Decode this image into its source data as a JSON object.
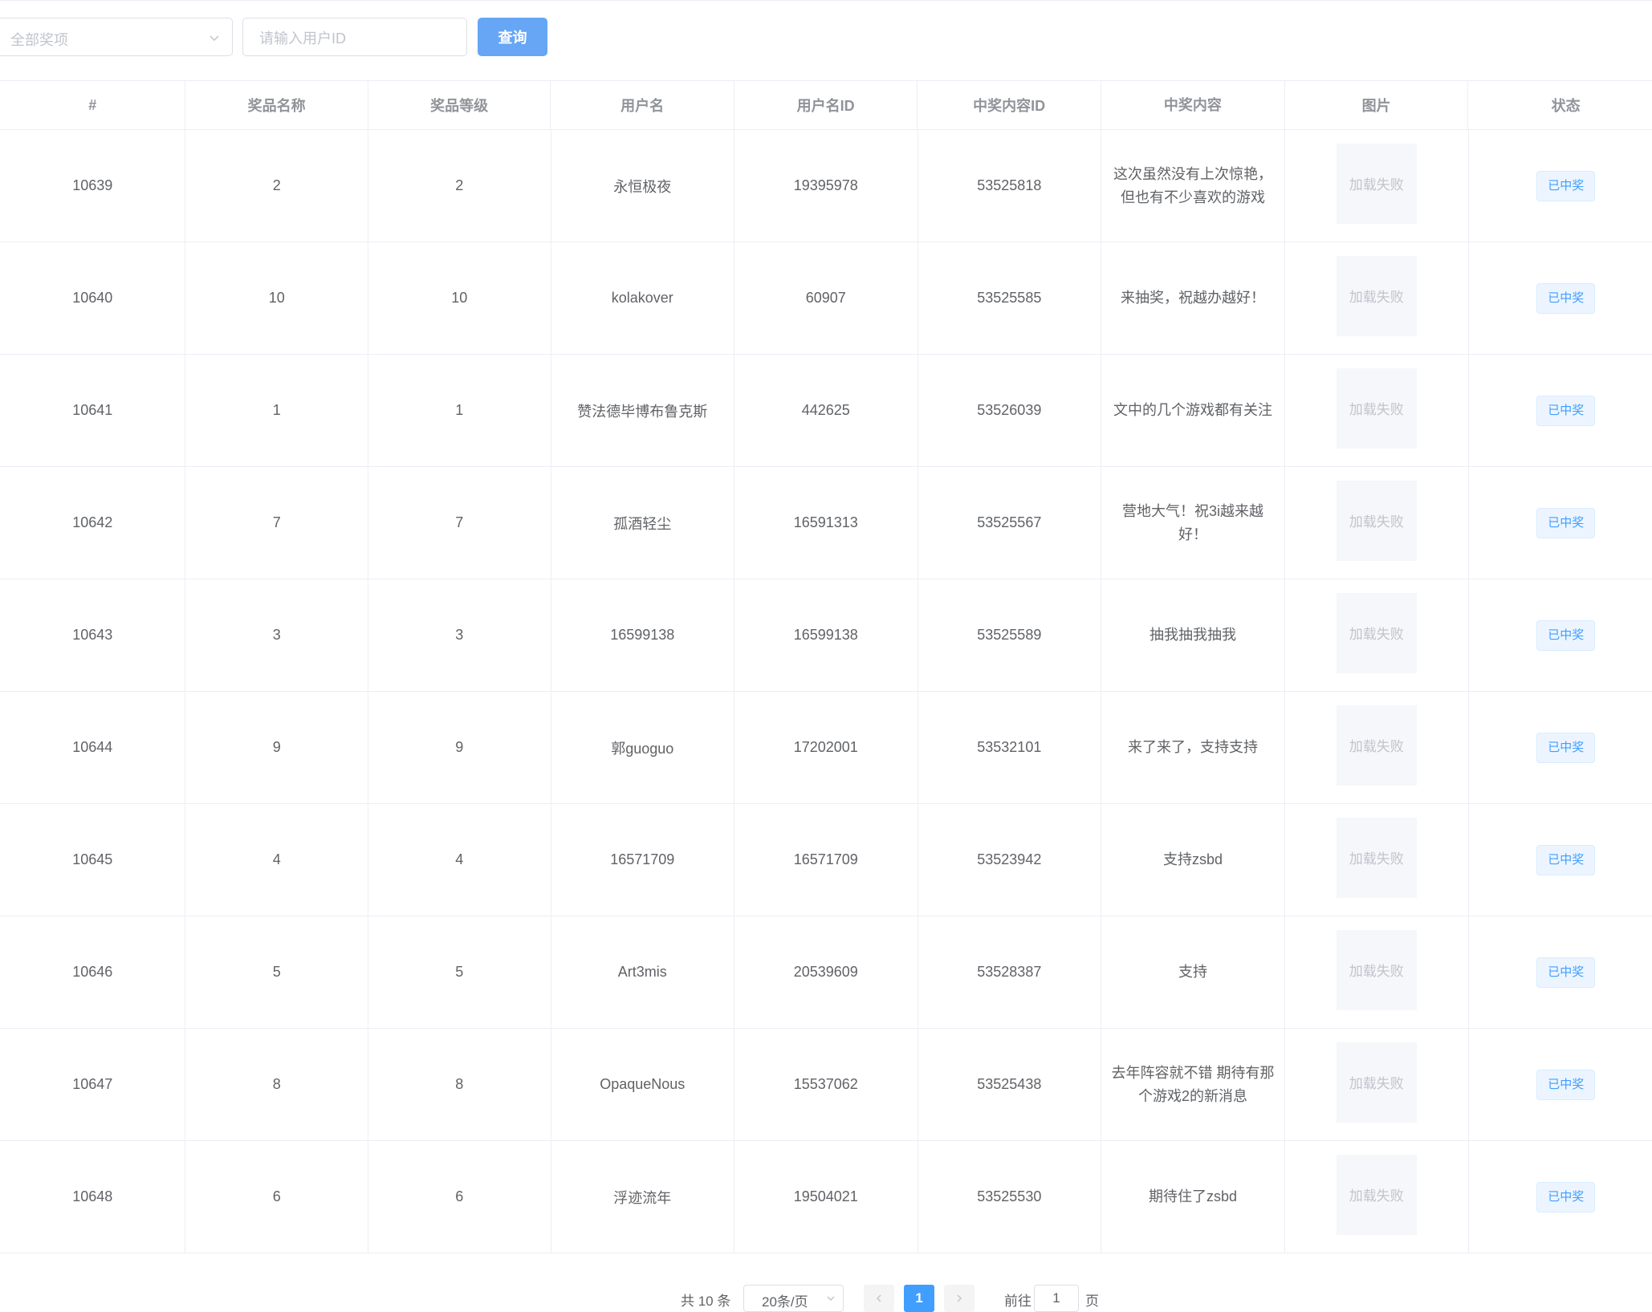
{
  "filter": {
    "prize_select": "全部奖项",
    "user_id_placeholder": "请输入用户ID",
    "query_button": "查询"
  },
  "table": {
    "headers": [
      "#",
      "奖品名称",
      "奖品等级",
      "用户名",
      "用户名ID",
      "中奖内容ID",
      "中奖内容",
      "图片",
      "状态"
    ],
    "rows": [
      {
        "id": "10639",
        "prize_name": "2",
        "prize_level": "2",
        "username": "永恒极夜",
        "user_id": "19395978",
        "content_id": "53525818",
        "content": "这次虽然没有上次惊艳，但也有不少喜欢的游戏",
        "image": "加载失败",
        "status": "已中奖"
      },
      {
        "id": "10640",
        "prize_name": "10",
        "prize_level": "10",
        "username": "kolakover",
        "user_id": "60907",
        "content_id": "53525585",
        "content": "来抽奖，祝越办越好！",
        "image": "加载失败",
        "status": "已中奖"
      },
      {
        "id": "10641",
        "prize_name": "1",
        "prize_level": "1",
        "username": "赞法德毕博布鲁克斯",
        "user_id": "442625",
        "content_id": "53526039",
        "content": "文中的几个游戏都有关注",
        "image": "加载失败",
        "status": "已中奖"
      },
      {
        "id": "10642",
        "prize_name": "7",
        "prize_level": "7",
        "username": "孤酒轻尘",
        "user_id": "16591313",
        "content_id": "53525567",
        "content": "营地大气！祝3i越来越好！",
        "image": "加载失败",
        "status": "已中奖"
      },
      {
        "id": "10643",
        "prize_name": "3",
        "prize_level": "3",
        "username": "16599138",
        "user_id": "16599138",
        "content_id": "53525589",
        "content": "抽我抽我抽我",
        "image": "加载失败",
        "status": "已中奖"
      },
      {
        "id": "10644",
        "prize_name": "9",
        "prize_level": "9",
        "username": "郭guoguo",
        "user_id": "17202001",
        "content_id": "53532101",
        "content": "来了来了，支持支持",
        "image": "加载失败",
        "status": "已中奖"
      },
      {
        "id": "10645",
        "prize_name": "4",
        "prize_level": "4",
        "username": "16571709",
        "user_id": "16571709",
        "content_id": "53523942",
        "content": "支持zsbd",
        "image": "加载失败",
        "status": "已中奖"
      },
      {
        "id": "10646",
        "prize_name": "5",
        "prize_level": "5",
        "username": "Art3mis",
        "user_id": "20539609",
        "content_id": "53528387",
        "content": "支持",
        "image": "加载失败",
        "status": "已中奖"
      },
      {
        "id": "10647",
        "prize_name": "8",
        "prize_level": "8",
        "username": "OpaqueNous",
        "user_id": "15537062",
        "content_id": "53525438",
        "content": "去年阵容就不错 期待有那个游戏2的新消息",
        "image": "加载失败",
        "status": "已中奖"
      },
      {
        "id": "10648",
        "prize_name": "6",
        "prize_level": "6",
        "username": "浮迹流年",
        "user_id": "19504021",
        "content_id": "53525530",
        "content": "期待住了zsbd",
        "image": "加载失败",
        "status": "已中奖"
      }
    ]
  },
  "pagination": {
    "total": "共 10 条",
    "page_size": "20条/页",
    "current_page": "1",
    "goto_label": "前往",
    "goto_value": "1",
    "page_label": "页"
  },
  "icons": {
    "select_chevron": "chevron-down-icon",
    "prev": "chevron-left-icon",
    "next": "chevron-right-icon"
  },
  "colors": {
    "primary": "#409eff",
    "query_button": "#66a6f5",
    "border": "#ebeef5"
  }
}
